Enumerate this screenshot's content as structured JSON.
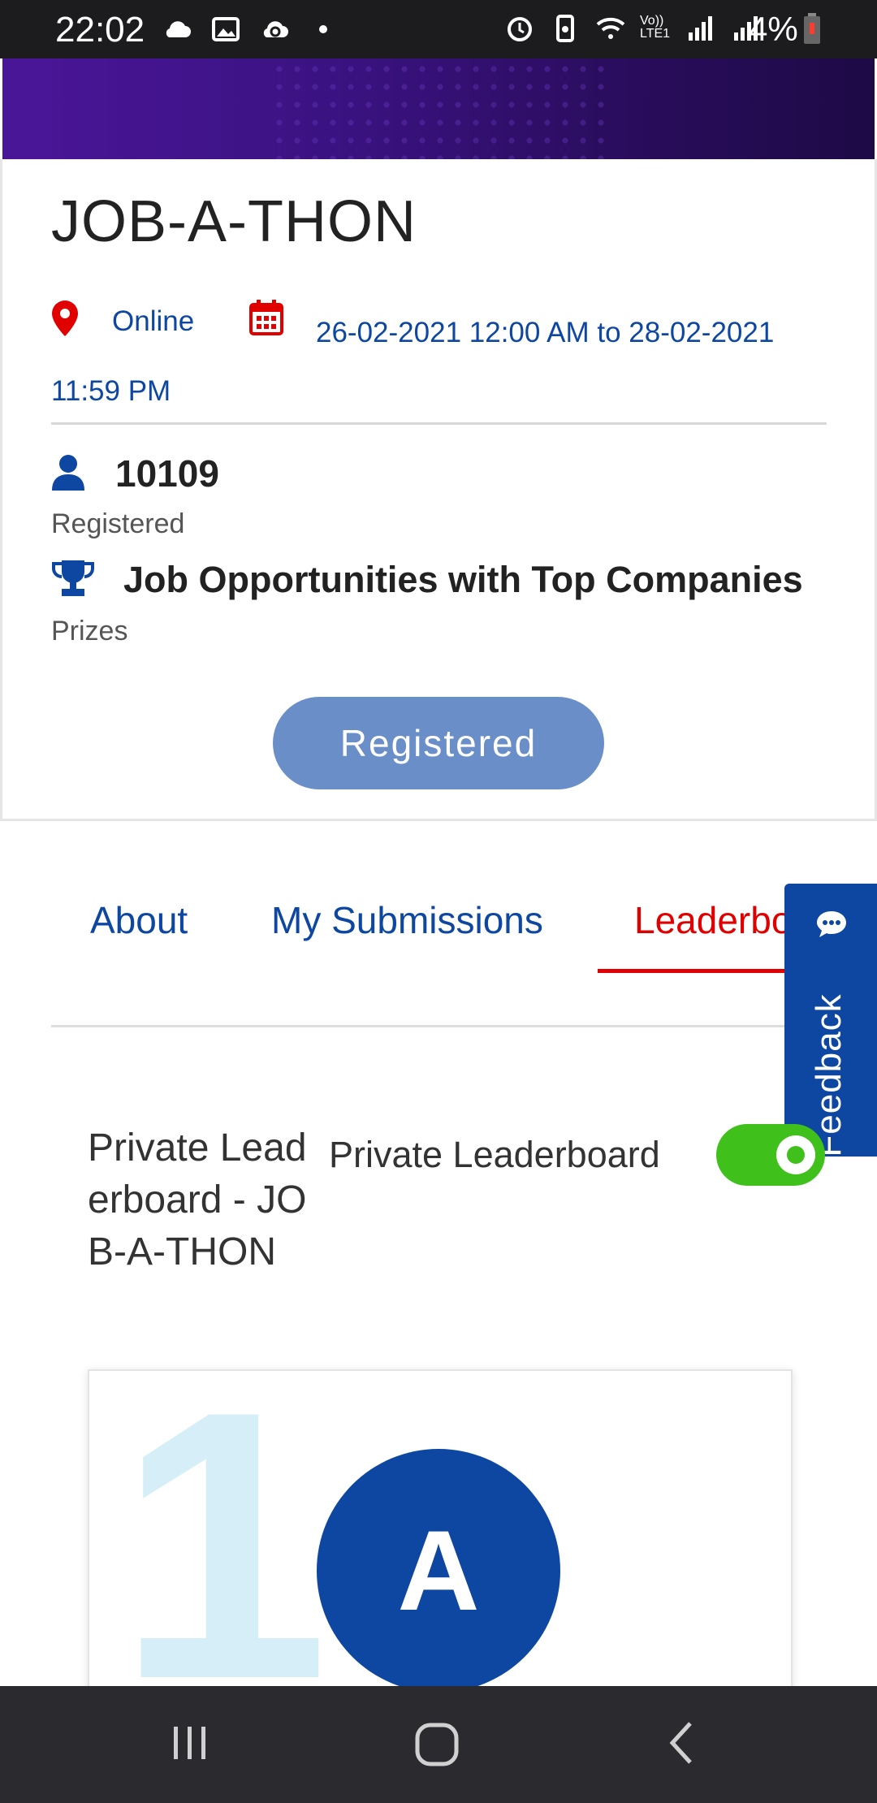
{
  "status_bar": {
    "time": "22:02",
    "battery_percent": "4%",
    "network_label": "Vo)) LTE1",
    "left_icons": [
      "cloud-icon",
      "image-icon",
      "cloud-sync-icon",
      "dot-icon"
    ],
    "right_icons": [
      "alarm-icon",
      "battery-saver-icon",
      "wifi-icon",
      "signal-icon",
      "signal-roaming-icon",
      "battery-icon"
    ]
  },
  "event": {
    "title": "JOB-A-THON",
    "location": "Online",
    "date_range": "26-02-2021 12:00 AM to 28-02-2021 11:59 PM",
    "registered_count": "10109",
    "registered_label": "Registered",
    "prize": "Job Opportunities with Top Companies",
    "prize_label": "Prizes",
    "register_button_label": "Registered"
  },
  "tabs": [
    {
      "label": "About"
    },
    {
      "label": "My Submissions"
    },
    {
      "label": "Leaderboard",
      "active": true
    }
  ],
  "feedback": {
    "label": "Feedback"
  },
  "leaderboard": {
    "private_title": "Private Leaderboard - JOB-A-THON",
    "toggle_label": "Private Leaderboard",
    "toggle_on": true,
    "top_rank": "1",
    "top_avatar_letter": "A"
  },
  "colors": {
    "primary_blue": "#0d47a1",
    "accent_red": "#e00000",
    "toggle_green": "#40c01a",
    "button_blue": "#6a8fc8"
  }
}
